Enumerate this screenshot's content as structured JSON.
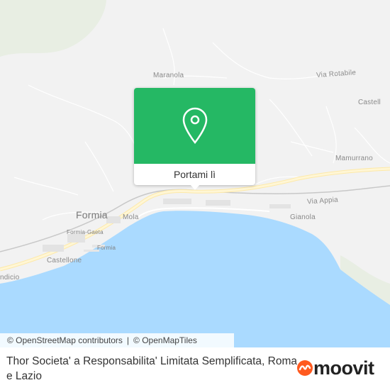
{
  "map": {
    "places": {
      "maranola": "Maranola",
      "via_rotabile": "Via Rotabile",
      "castellonorato": "Castell",
      "mamurrano": "Mamurrano",
      "formia": "Formia",
      "mola": "Mola",
      "via_appia": "Via Appia",
      "gianola": "Gianola",
      "formia_gaeta": "Formia-Gaeta",
      "formia_port": "Formia",
      "castellone": "Castellone",
      "ndicio": "ndicio"
    },
    "colors": {
      "land": "#f2f2f2",
      "sea": "#aadaff",
      "road_major": "#fff3c4",
      "road_minor": "#ffffff"
    }
  },
  "popup": {
    "pin_icon": "location-pin-icon",
    "button_label": "Portami lì",
    "color": "#25b864"
  },
  "attribution": {
    "osm": "© OpenStreetMap contributors",
    "separator": "|",
    "omt": "© OpenMapTiles"
  },
  "footer": {
    "title": "Thor Societa' a Responsabilita' Limitata Semplificata, Roma e Lazio",
    "brand": "moovit",
    "brand_icon": "moovit-logo-icon",
    "brand_color": "#ff5a1f"
  }
}
